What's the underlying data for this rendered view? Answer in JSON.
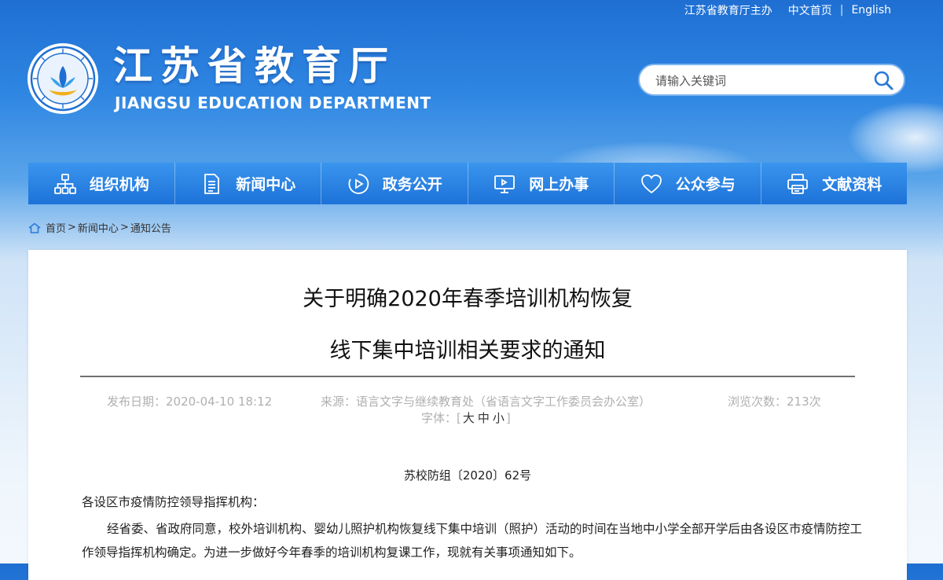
{
  "toplinks": {
    "host": "江苏省教育厅主办",
    "chinese": "中文首页",
    "english": "English",
    "sep": "|"
  },
  "logo": {
    "cn": "江苏省教育厅",
    "en": "JIANGSU EDUCATION DEPARTMENT"
  },
  "search": {
    "placeholder": "请输入关键词"
  },
  "nav": [
    {
      "label": "组织机构",
      "icon": "org-chart-icon"
    },
    {
      "label": "新闻中心",
      "icon": "document-icon"
    },
    {
      "label": "政务公开",
      "icon": "play-circle-icon"
    },
    {
      "label": "网上办事",
      "icon": "monitor-icon"
    },
    {
      "label": "公众参与",
      "icon": "heart-icon"
    },
    {
      "label": "文献资料",
      "icon": "printer-icon"
    }
  ],
  "breadcrumb": {
    "home": "首页",
    "news": "新闻中心",
    "notice": "通知公告",
    "sep": ">"
  },
  "article": {
    "title_line1": "关于明确2020年春季培训机构恢复",
    "title_line2": "线下集中培训相关要求的通知",
    "date": "发布日期：2020-04-10 18:12",
    "source": "来源：语言文字与继续教育处（省语言文字工作委员会办公室）",
    "views": "浏览次数：213次",
    "fontsize_label": "字体：",
    "fontsize_open": "[",
    "fontsize_close": "]",
    "fontsize_large": "大",
    "fontsize_medium": "中",
    "fontsize_small": "小",
    "doc_number": "苏校防组〔2020〕62号",
    "salutation": "各设区市疫情防控领导指挥机构：",
    "paragraph1": "经省委、省政府同意，校外培训机构、婴幼儿照护机构恢复线下集中培训（照护）活动的时间在当地中小学全部开学后由各设区市疫情防控工作领导指挥机构确定。为进一步做好今年春季的培训机构复课工作，现就有关事项通知如下。"
  },
  "colors": {
    "nav_top": "#3a95ee",
    "nav_bottom": "#1d72d8",
    "sky": "#2f86e2",
    "search_border": "#7fb4ef"
  }
}
